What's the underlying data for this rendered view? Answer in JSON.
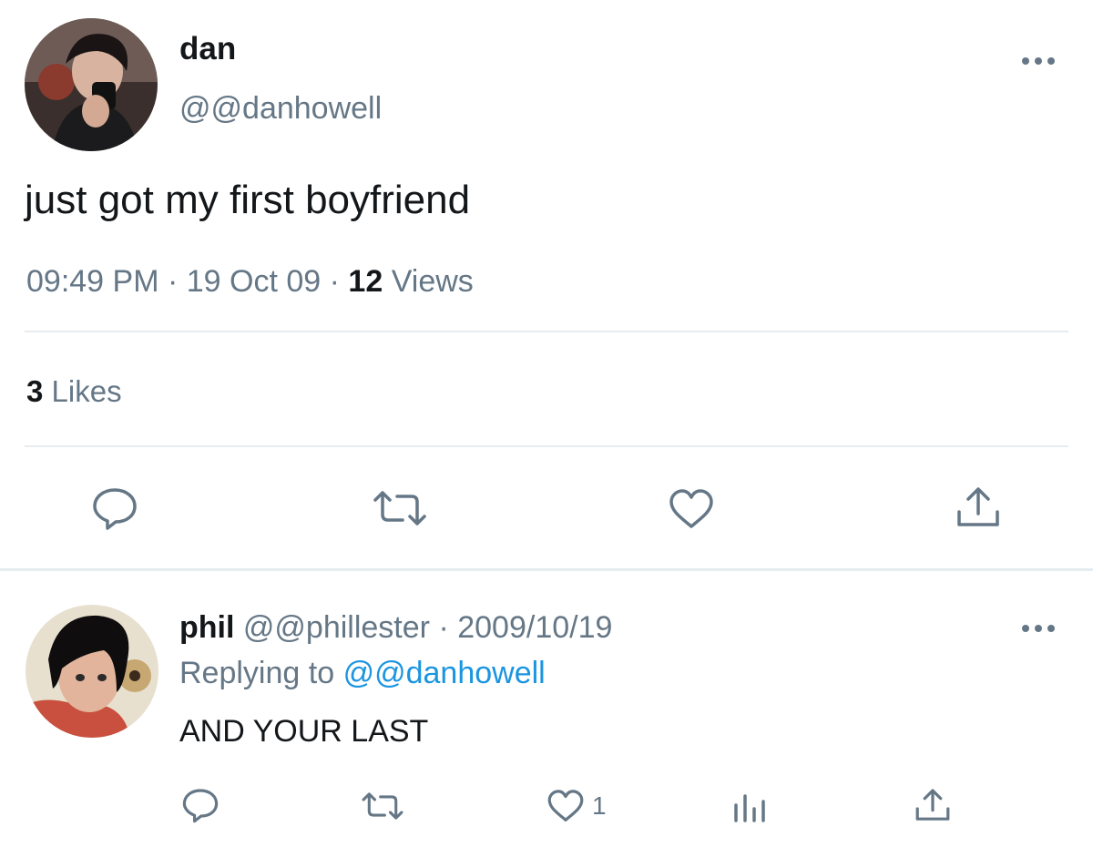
{
  "main_tweet": {
    "author_name": "dan",
    "author_handle": "@@danhowell",
    "text": "just got my first boyfriend",
    "time": "09:49 PM",
    "date": "19 Oct 09",
    "separator": "·",
    "views_count": "12",
    "views_label": "Views",
    "likes_count": "3",
    "likes_label": "Likes",
    "actions": [
      "reply-icon",
      "retweet-icon",
      "like-icon",
      "share-icon"
    ]
  },
  "reply": {
    "author_name": "phil",
    "author_handle": "@@phillester",
    "separator": "·",
    "date": "2009/10/19",
    "replying_to_label": "Replying to",
    "replying_to_handle": "@@danhowell",
    "text": "AND YOUR LAST",
    "like_count": "1",
    "actions": [
      "reply-icon",
      "retweet-icon",
      "like-icon",
      "analytics-icon",
      "share-icon"
    ]
  },
  "colors": {
    "text": "#14171a",
    "secondary": "#657786",
    "link": "#1b95e0",
    "divider": "#e6ecf0"
  }
}
